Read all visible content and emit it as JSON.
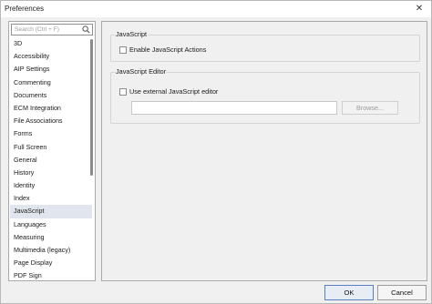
{
  "window": {
    "title": "Preferences",
    "close_glyph": "✕"
  },
  "search": {
    "placeholder": "Search (Ctrl + F)",
    "icon": "search-icon"
  },
  "sidebar": {
    "items": [
      {
        "label": "3D"
      },
      {
        "label": "Accessibility"
      },
      {
        "label": "AIP Settings"
      },
      {
        "label": "Commenting"
      },
      {
        "label": "Documents"
      },
      {
        "label": "ECM Integration"
      },
      {
        "label": "File Associations"
      },
      {
        "label": "Forms"
      },
      {
        "label": "Full Screen"
      },
      {
        "label": "General"
      },
      {
        "label": "History"
      },
      {
        "label": "Identity"
      },
      {
        "label": "Index"
      },
      {
        "label": "JavaScript",
        "selected": true
      },
      {
        "label": "Languages"
      },
      {
        "label": "Measuring"
      },
      {
        "label": "Multimedia (legacy)"
      },
      {
        "label": "Page Display"
      },
      {
        "label": "PDF Sign"
      }
    ]
  },
  "javascript_group": {
    "label": "JavaScript",
    "enable_label": "Enable JavaScript Actions",
    "enable_checked": false
  },
  "editor_group": {
    "label": "JavaScript Editor",
    "external_label": "Use external JavaScript editor",
    "external_checked": false,
    "path_value": "",
    "browse_label": "Browse..."
  },
  "footer": {
    "ok_label": "OK",
    "cancel_label": "Cancel"
  },
  "colors": {
    "selected_row": "#e1e6ee",
    "ok_border": "#5a7fbf",
    "disabled_text": "#9b9b9b"
  }
}
